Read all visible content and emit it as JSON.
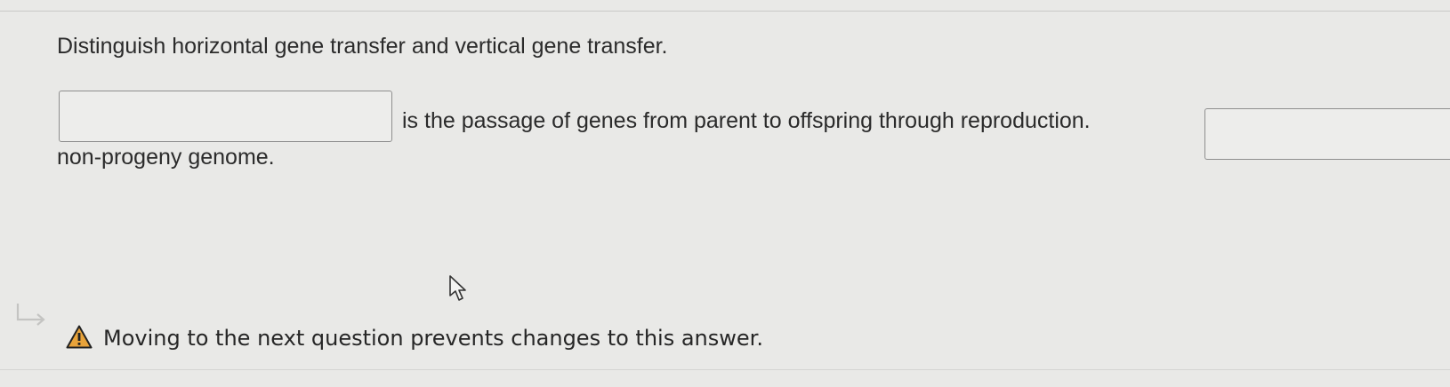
{
  "question": {
    "prompt": "Distinguish horizontal gene transfer and vertical gene transfer."
  },
  "fill_in": {
    "blank_1_value": "",
    "sentence_part_1": "is the passage of genes from parent to offspring through reproduction.",
    "blank_2_value": "",
    "sentence_part_2": "non-progeny genome."
  },
  "notice": {
    "icon": "warning-icon",
    "text": "Moving to the next question prevents changes to this answer.",
    "icon_color": "#e8a33a"
  }
}
